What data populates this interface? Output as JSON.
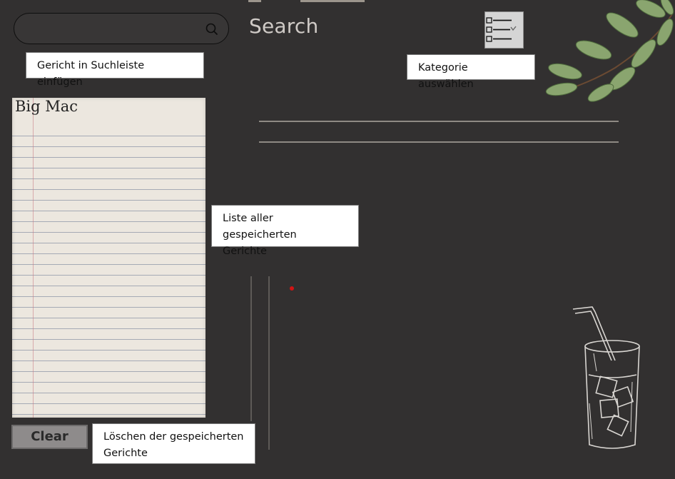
{
  "search": {
    "title": "Search",
    "placeholder": "",
    "value": ""
  },
  "annotations": {
    "search_hint": "Gericht in Suchleiste einfügen",
    "category_hint": "Kategorie auswählen",
    "list_hint_line1": "Liste aller gespeicherten",
    "list_hint_line2": "Gerichte",
    "clear_hint_line1": "Löschen der gespeicherten",
    "clear_hint_line2": "Gerichte"
  },
  "saved_dishes": {
    "items": [
      "Big Mac"
    ]
  },
  "buttons": {
    "clear_label": "Clear"
  },
  "icons": {
    "search": "magnifier-icon",
    "category": "checklist-icon",
    "leaves": "leaf-branch-icon",
    "glass": "drink-glass-icon"
  },
  "colors": {
    "background": "#323030",
    "paper": "#ece7df",
    "accent_dot": "#d21414"
  }
}
